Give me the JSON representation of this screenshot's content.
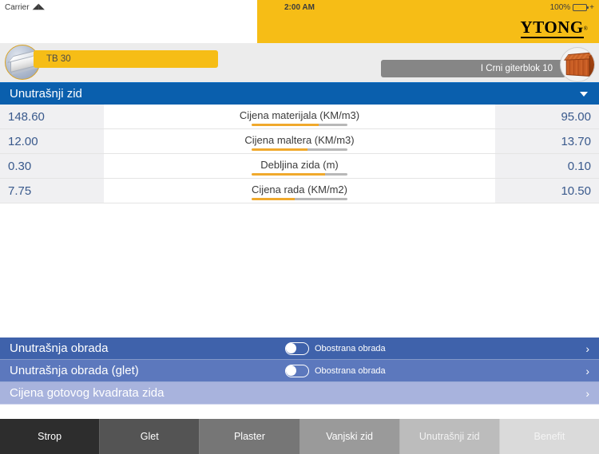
{
  "status_bar": {
    "carrier": "Carrier",
    "wifi_icon": "wifi-icon",
    "time": "2:00 AM",
    "battery_percent": "100%",
    "battery_plug": "+"
  },
  "navbar": {
    "title": "Unutrašnji zid",
    "logo_text": "YTONG",
    "logo_registered": "®",
    "accent_color": "#f6bd16"
  },
  "selector": {
    "left_product_label": "TB 30",
    "left_thumb_icon": "aac-block-icon",
    "right_product_label": "I Crni giterblok 10",
    "right_thumb_icon": "clay-brick-icon",
    "left_bar_color": "#f6bd16",
    "right_bar_color": "#868686"
  },
  "section": {
    "title": "Unutrašnji zid",
    "collapse_icon": "chevron-down-icon",
    "header_color": "#0a5fad"
  },
  "table": {
    "rows": [
      {
        "left_value": "148.60",
        "label": "Cijena materijala (KM/m3)",
        "right_value": "95.00",
        "slider_fill_percent": 70
      },
      {
        "left_value": "12.00",
        "label": "Cijena maltera (KM/m3)",
        "right_value": "13.70",
        "slider_fill_percent": 58
      },
      {
        "left_value": "0.30",
        "label": "Debljina zida (m)",
        "right_value": "0.10",
        "slider_fill_percent": 77
      },
      {
        "left_value": "7.75",
        "label": "Cijena rada (KM/m2)",
        "right_value": "10.50",
        "slider_fill_percent": 45
      }
    ]
  },
  "options": [
    {
      "label": "Unutrašnja obrada",
      "toggle_state": "off",
      "toggle_label": "Obostrana obrada",
      "has_toggle": true,
      "disclosure_icon": "chevron-right-icon"
    },
    {
      "label": "Unutrašnja obrada (glet)",
      "toggle_state": "off",
      "toggle_label": "Obostrana obrada",
      "has_toggle": true,
      "disclosure_icon": "chevron-right-icon"
    },
    {
      "label": "Cijena gotovog kvadrata zida",
      "toggle_state": null,
      "toggle_label": "",
      "has_toggle": false,
      "disclosure_icon": "chevron-right-icon"
    }
  ],
  "tabbar": {
    "tabs": [
      {
        "label": "Strop",
        "bg": "#2d2d2d",
        "fg": "#ffffff"
      },
      {
        "label": "Glet",
        "bg": "#545454",
        "fg": "#ffffff"
      },
      {
        "label": "Plaster",
        "bg": "#767676",
        "fg": "#ffffff"
      },
      {
        "label": "Vanjski zid",
        "bg": "#9a9a9a",
        "fg": "#ffffff"
      },
      {
        "label": "Unutrašnji zid",
        "bg": "#bcbcbc",
        "fg": "#f2f2f2"
      },
      {
        "label": "Benefit",
        "bg": "#dadada",
        "fg": "#f4f4f4"
      }
    ]
  }
}
